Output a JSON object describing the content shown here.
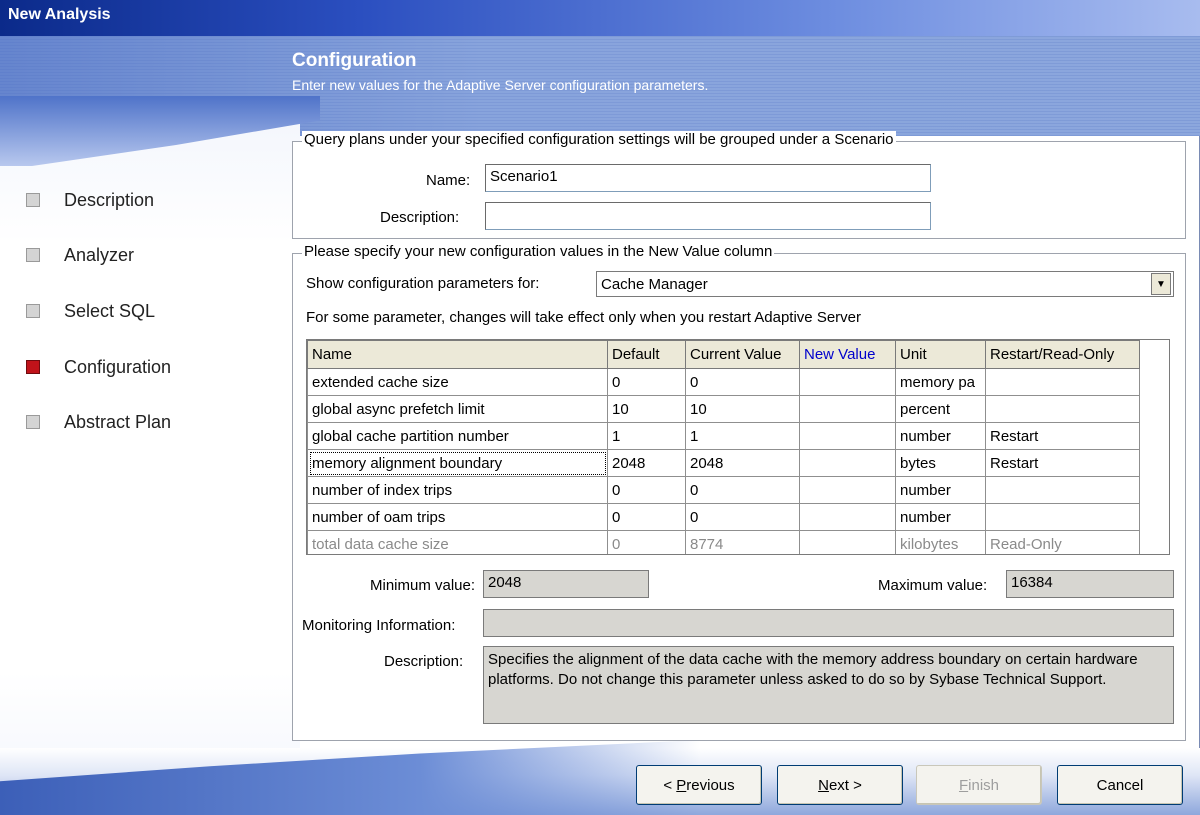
{
  "window": {
    "title": "New Analysis"
  },
  "header": {
    "title": "Configuration",
    "subtitle": "Enter new values for the Adaptive Server configuration parameters."
  },
  "nav": {
    "items": [
      {
        "label": "Description",
        "active": false
      },
      {
        "label": "Analyzer",
        "active": false
      },
      {
        "label": "Select SQL",
        "active": false
      },
      {
        "label": "Configuration",
        "active": true
      },
      {
        "label": "Abstract Plan",
        "active": false
      }
    ]
  },
  "scenario": {
    "group_label": "Query plans under your specified configuration settings will be grouped under a Scenario",
    "name_label": "Name:",
    "name_value": "Scenario1",
    "description_label": "Description:",
    "description_value": ""
  },
  "config": {
    "group_label": "Please specify your new configuration values in the New Value column",
    "show_label": "Show configuration parameters for:",
    "show_value": "Cache Manager",
    "restart_note": "For some parameter, changes will take effect only when you restart Adaptive Server",
    "columns": [
      "Name",
      "Default",
      "Current Value",
      "New Value",
      "Unit",
      "Restart/Read-Only"
    ],
    "rows": [
      [
        "extended cache size",
        "0",
        "0",
        "",
        "memory pa",
        ""
      ],
      [
        "global async prefetch limit",
        "10",
        "10",
        "",
        "percent",
        ""
      ],
      [
        "global cache partition number",
        "1",
        "1",
        "",
        "number",
        "Restart"
      ],
      [
        "memory alignment boundary",
        "2048",
        "2048",
        "",
        "bytes",
        "Restart"
      ],
      [
        "number of index trips",
        "0",
        "0",
        "",
        "number",
        ""
      ],
      [
        "number of oam trips",
        "0",
        "0",
        "",
        "number",
        ""
      ],
      [
        "total data cache size",
        "0",
        "8774",
        "",
        "kilobytes",
        "Read-Only"
      ]
    ],
    "selected_row": 3,
    "disabled_row": 6,
    "min_label": "Minimum value:",
    "min_value": "2048",
    "max_label": "Maximum value:",
    "max_value": "16384",
    "monitoring_label": "Monitoring Information:",
    "monitoring_value": "",
    "description_label": "Description:",
    "description_value": "Specifies the alignment of the data cache with the memory address boundary on certain hardware platforms. Do not change this parameter unless asked to do so by Sybase Technical Support."
  },
  "buttons": {
    "previous_prefix": "< ",
    "previous_mnemonic": "P",
    "previous_rest": "revious",
    "next_mnemonic": "N",
    "next_rest": "ext >",
    "finish_mnemonic": "F",
    "finish_rest": "inish",
    "cancel": "Cancel"
  },
  "colors": {
    "active_step": "#c0131a",
    "title_bar": "#0b2a8a",
    "new_value_header": "#0000cc"
  }
}
